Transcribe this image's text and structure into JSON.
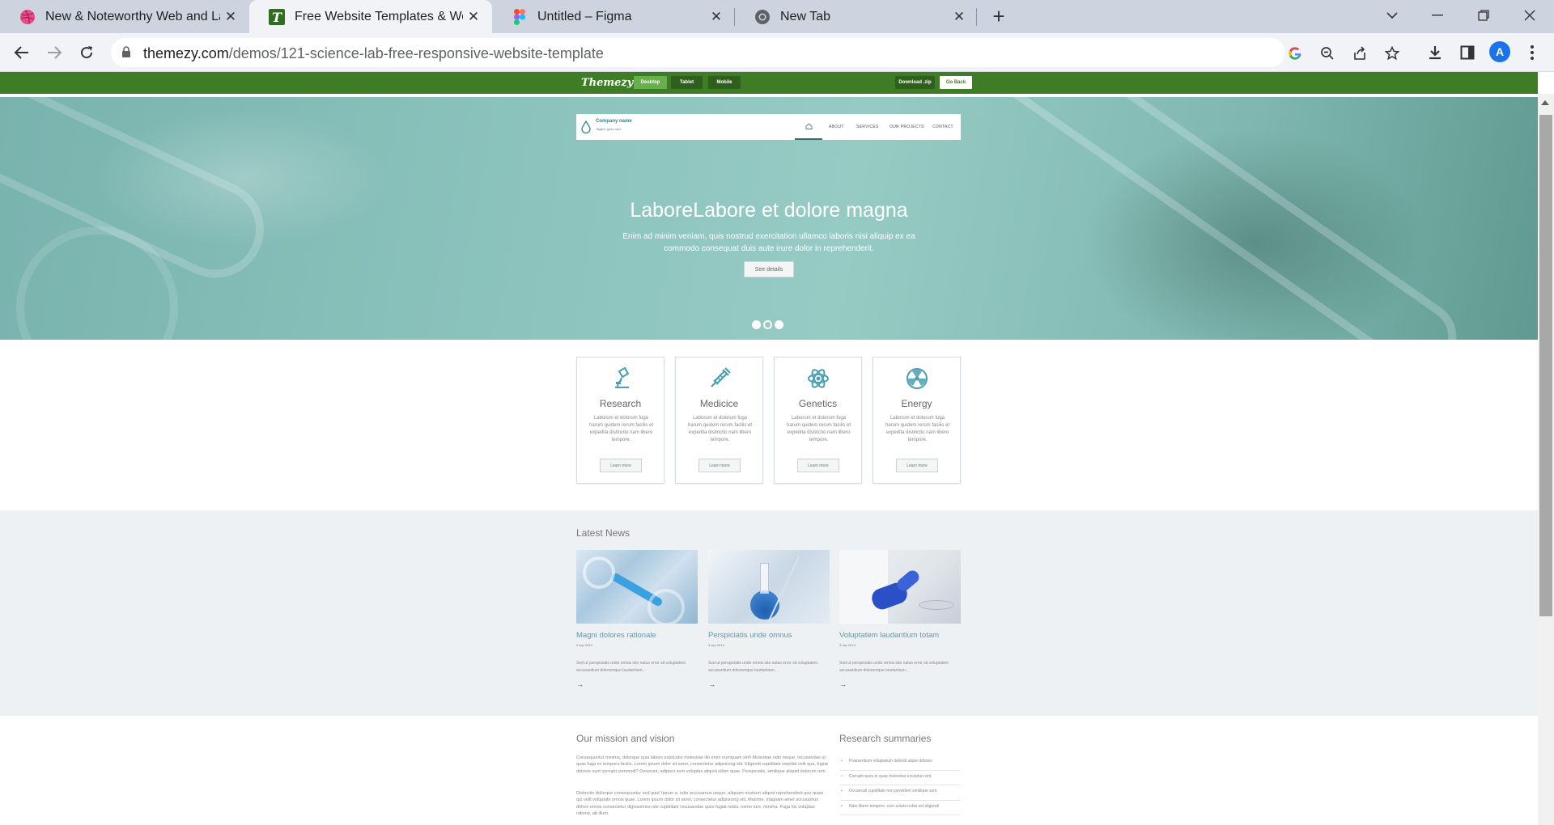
{
  "browser": {
    "tabs": [
      {
        "title": "New & Noteworthy Web and Landing Pages",
        "active": false
      },
      {
        "title": "Free Website Templates & WordPress Themes",
        "active": true
      },
      {
        "title": "Untitled – Figma",
        "active": false
      },
      {
        "title": "New Tab",
        "active": false
      }
    ],
    "url_host": "themezy.com",
    "url_path": "/demos/121-science-lab-free-responsive-website-template",
    "avatar_letter": "A",
    "colors": {
      "tabstrip": "#ced4df",
      "toolbar": "#f1f3f6",
      "avatar": "#1a73e8"
    }
  },
  "themezy_bar": {
    "logo": "Themezy",
    "devices": [
      "Desktop",
      "Tablet",
      "Mobile"
    ],
    "selected_device": "Desktop",
    "download_label": "Download .zip",
    "go_back_label": "Go Back",
    "color": "#3e7d25"
  },
  "site": {
    "company_name": "Company name",
    "tagline": "Tagline goes here",
    "menu": [
      "ABOUT",
      "SERVICES",
      "OUR PROJECTS",
      "CONTACT"
    ],
    "hero": {
      "title": "LaboreLabore et dolore magna",
      "text": "Enim ad minim veniam, quis nostrud exercitation ullamco laboris nisi aliquip ex ea commodo consequat duis aute irure dolor in reprehenderit.",
      "button": "See details",
      "slides": 3,
      "active_slide": 2
    },
    "services": [
      {
        "title": "Research",
        "icon": "microscope-icon",
        "text": "Laborum et dolorum fuga harum quidem rerum facilis et expedita distinctio nam libero tempore.",
        "button": "Learn more"
      },
      {
        "title": "Medicice",
        "icon": "syringe-icon",
        "text": "Laborum et dolorum fuga harum quidem rerum facilis et expedita distinctio nam libero tempore.",
        "button": "Learn more"
      },
      {
        "title": "Genetics",
        "icon": "atom-icon",
        "text": "Laborum et dolorum fuga harum quidem rerum facilis et expedita distinctio nam libero tempore.",
        "button": "Learn more"
      },
      {
        "title": "Energy",
        "icon": "radiation-icon",
        "text": "Laborum et dolorum fuga harum quidem rerum facilis et expedita distinctio nam libero tempore.",
        "button": "Learn more"
      }
    ],
    "news_heading": "Latest News",
    "news": [
      {
        "title": "Magni dolores rationale",
        "date": "3 sep 2014",
        "excerpt": "Sed ut perspiciatis unde omnis iste natus error sit voluptatem accusantium doloremque laudantium...",
        "image": "test-tube-image"
      },
      {
        "title": "Perspiciatis unde omnus",
        "date": "3 sep 2014",
        "excerpt": "Sed ut perspiciatis unde omnis iste natus error sit voluptatem accusantium doloremque laudantium...",
        "image": "flask-image"
      },
      {
        "title": "Voluptatem laudantium totam",
        "date": "3 sep 2014",
        "excerpt": "Sed ut perspiciatis unde omnis iste natus error sit voluptatem accusantium doloremque laudantium...",
        "image": "scientist-image"
      }
    ],
    "mission_heading": "Our mission and vision",
    "mission_paragraphs": [
      "Consequuntur minima, dolorque quia labore explicabo molestiae illo enim numquam sint! Molestiae odio neque, recusandae ut quas fuga ex tempora facilis. Lorem ipsum dolor sit amet, consectetur adipisicing elit. Eligendi cupiditate repellat velit qua, fugiat dolores sunt corrupti commodi? Deserunt, adipisci eum voluptas aliquid ullam quae. Perspiciatis, similique aliquid dolorum rem.",
      "Distinctio dolorque consequuntur sed quis! Ipsum a, odio accusamus neque, aliquam nostrum aliquid reprehenderit quo quasi qui velit voluptate omnis quae. Lorem ipsum dolor sit amet, consectetur adipisicing elit. Maxime, magnam amet accusamus dolore omnis consectetur dignissimos iste cupiditate recusandae quos fugiat nobis, nemo iure, minima. Fuga hic voluptas ratione, ab illum."
    ],
    "summaries_heading": "Research summaries",
    "summaries": [
      "Praesentium voluptatum deleniti atque dolores",
      "Corrupti quos et quas molestias excepturi sint",
      "Occaecati cupiditate non provident similique sunt",
      "Nam libero tempore, cum soluta nobis est eligendi"
    ]
  }
}
